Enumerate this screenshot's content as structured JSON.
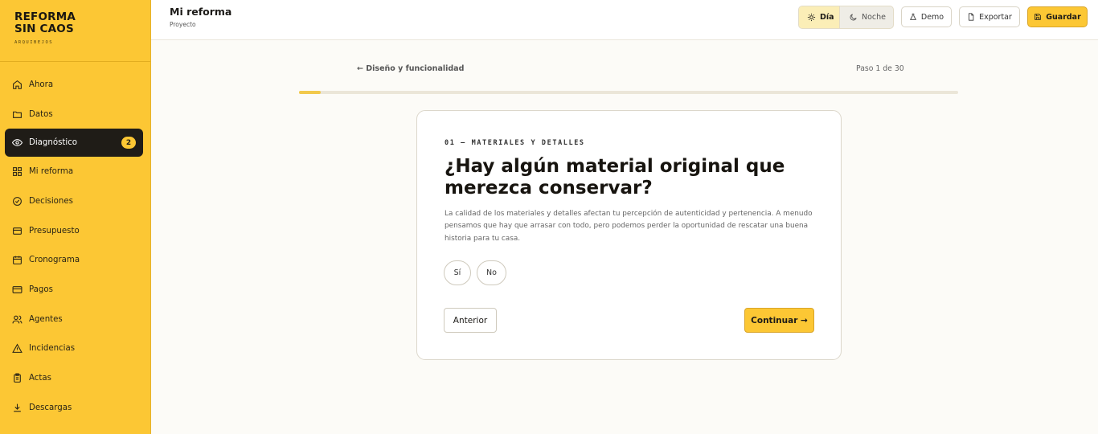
{
  "brand": {
    "line1": "REFORMA",
    "line2": "SIN CAOS",
    "sub": "ARQUIBEJOS"
  },
  "nav": [
    {
      "label": "Ahora",
      "icon": "home-icon"
    },
    {
      "label": "Datos",
      "icon": "folder-icon"
    },
    {
      "label": "Diagnóstico",
      "icon": "eye-icon",
      "active": true,
      "badge": "2"
    },
    {
      "label": "Mi reforma",
      "icon": "grid-icon"
    },
    {
      "label": "Decisiones",
      "icon": "check-circle-icon"
    },
    {
      "label": "Presupuesto",
      "icon": "wallet-icon"
    },
    {
      "label": "Cronograma",
      "icon": "calendar-icon"
    },
    {
      "label": "Pagos",
      "icon": "credit-card-icon"
    },
    {
      "label": "Agentes",
      "icon": "users-icon"
    },
    {
      "label": "Incidencias",
      "icon": "alert-triangle-icon"
    },
    {
      "label": "Actas",
      "icon": "clipboard-icon"
    },
    {
      "label": "Descargas",
      "icon": "download-icon"
    }
  ],
  "header": {
    "title": "Mi reforma",
    "subtitle": "Proyecto",
    "theme": {
      "day": "Día",
      "night": "Noche",
      "selected": "Día"
    },
    "demo": "Demo",
    "export": "Exportar",
    "save": "Guardar"
  },
  "wizard": {
    "back_link": "← Diseño y funcionalidad",
    "step": "Paso 1 de 30",
    "progress": 0.033,
    "eyebrow": "01 — MATERIALES Y DETALLES",
    "question": "¿Hay algún material original que merezca conservar?",
    "description": "La calidad de los materiales y detalles afectan tu percepción de autenticidad y pertenencia. A menudo pensamos que hay que arrasar con todo, pero podemos perder la oportunidad de rescatar una buena historia para tu casa.",
    "options": [
      "Sí",
      "No"
    ],
    "prev": "Anterior",
    "next": "Continuar →"
  },
  "colors": {
    "accent": "#fcc734",
    "dark": "#1f1c17",
    "background": "#fcfbf7"
  }
}
